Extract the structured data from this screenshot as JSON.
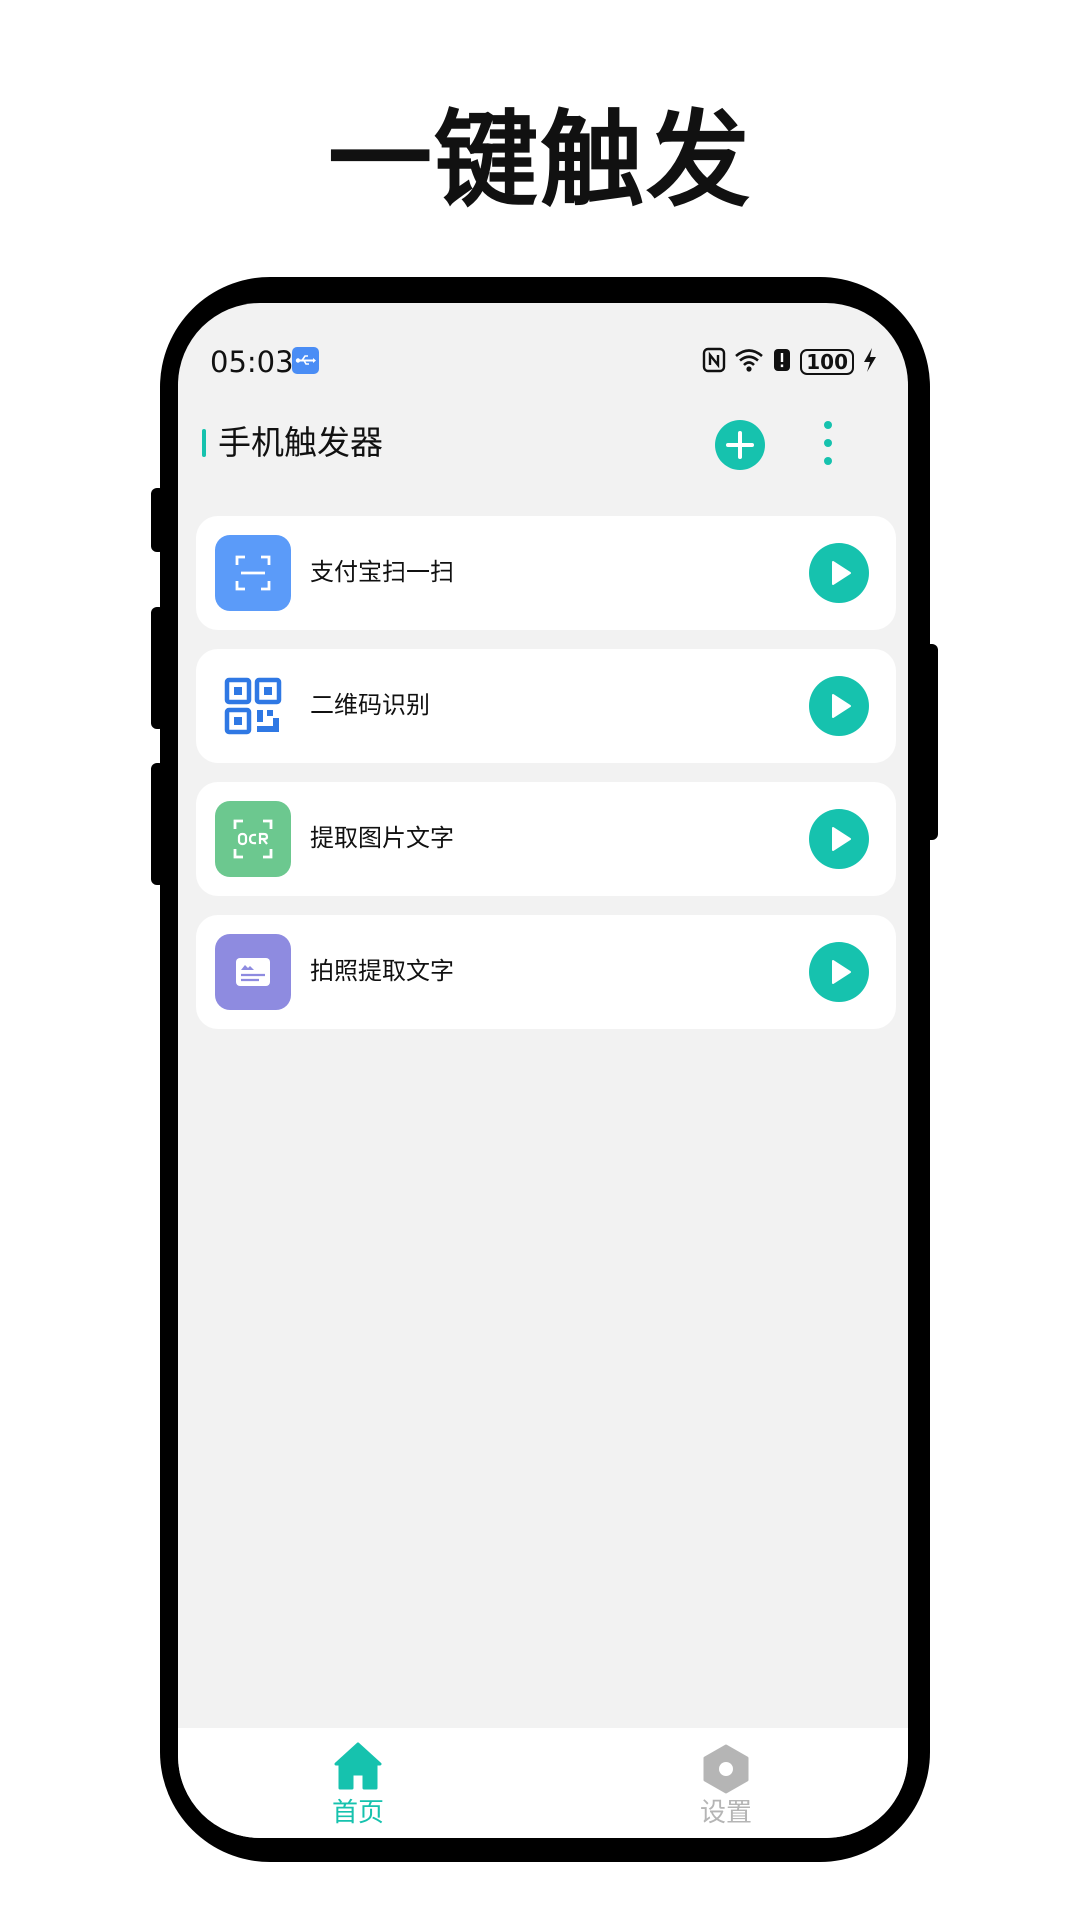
{
  "headline": "一键触发",
  "status_bar": {
    "time": "05:03",
    "battery_level": "100"
  },
  "app_bar": {
    "title": "手机触发器"
  },
  "actions": [
    {
      "label": "支付宝扫一扫",
      "icon": "scan-icon",
      "icon_bg": "#5b9bf9"
    },
    {
      "label": "二维码识别",
      "icon": "qr-code-icon",
      "icon_bg": "#ffffff"
    },
    {
      "label": "提取图片文字",
      "icon": "ocr-icon",
      "icon_bg": "#6cc88f"
    },
    {
      "label": "拍照提取文字",
      "icon": "photo-card-icon",
      "icon_bg": "#8e8be0"
    }
  ],
  "bottom_nav": {
    "items": [
      {
        "label": "首页",
        "icon": "home-icon",
        "active": true
      },
      {
        "label": "设置",
        "icon": "settings-icon",
        "active": false
      }
    ]
  },
  "colors": {
    "accent": "#16c2ae",
    "inactive": "#b5b5b5",
    "background": "#f2f2f2"
  }
}
